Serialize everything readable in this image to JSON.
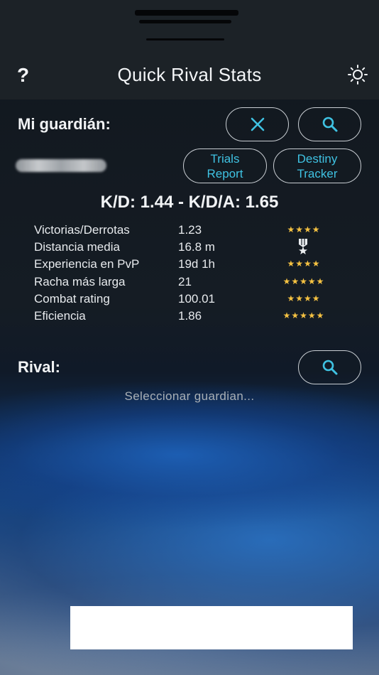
{
  "header": {
    "title": "Quick Rival Stats",
    "help_label": "?",
    "help_icon": "question-icon",
    "settings_icon": "sun-icon"
  },
  "my_guardian": {
    "label": "Mi guardián:",
    "clear_icon": "close-icon",
    "search_icon": "search-icon",
    "trials_report_label_1": "Trials",
    "trials_report_label_2": "Report",
    "destiny_tracker_label_1": "Destiny",
    "destiny_tracker_label_2": "Tracker",
    "kd_text": "K/D: 1.44 - K/D/A: 1.65",
    "stats": [
      {
        "label": "Victorias/Derrotas",
        "value": "1.23",
        "rating": "★★★★",
        "stars": 4
      },
      {
        "label": "Distancia media",
        "value": "16.8 m",
        "rating": "medal",
        "stars": 0
      },
      {
        "label": "Experiencia en PvP",
        "value": "19d 1h",
        "rating": "★★★★",
        "stars": 4
      },
      {
        "label": "Racha más larga",
        "value": "21",
        "rating": "★★★★★",
        "stars": 5
      },
      {
        "label": "Combat rating",
        "value": "100.01",
        "rating": "★★★★",
        "stars": 4
      },
      {
        "label": "Eficiencia",
        "value": "1.86",
        "rating": "★★★★★",
        "stars": 5
      }
    ]
  },
  "rival": {
    "label": "Rival:",
    "search_icon": "search-icon",
    "placeholder": "Seleccionar guardian..."
  },
  "colors": {
    "accent": "#3fc2e2",
    "star": "#f5c242",
    "header_bg": "#1c2227"
  }
}
